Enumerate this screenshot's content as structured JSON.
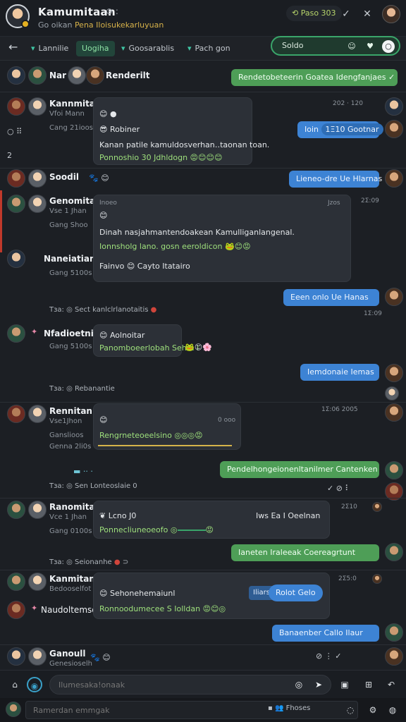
{
  "header": {
    "title": "Kamumitaan",
    "title_badges": "⊙ :",
    "subtitle_prefix": "Go oikan",
    "subtitle_accent": "Pena Iloisukekarluyuan",
    "chip": "⟲ Paso 303",
    "icons": [
      "check-icon",
      "close-icon",
      "tools-icon"
    ]
  },
  "tabs": {
    "items": [
      "Lannilie",
      "Uogiha",
      "Goosarablis",
      "Pach gon"
    ],
    "active_index": 1
  },
  "search": {
    "label": "Soldo"
  },
  "messages": {
    "r1": {
      "name": "Nar",
      "name2": "Renderilt",
      "out_text": "Rendetobeteerin Goatea Idengfanjaes",
      "out_icon": "✓"
    },
    "r2": {
      "name": "Kannmitan",
      "meta1": "Vfoi Mann",
      "meta2": "Cang 21ioos",
      "bubble_line1": "😊 ●",
      "bubble_line2": "😎 Robiner",
      "bubble_main": "Kanan patile  kamuldosverhan‥taonan toan.",
      "bubble_green": "Ponnoshio  30 Jdhldogn",
      "time_top": "202  ·  120",
      "out_text": "Ioin",
      "out_chip": "1Ξ10 Gootnar",
      "side_icons": "○ ⠿",
      "side_count": "2"
    },
    "r3": {
      "name": "Soodil",
      "out_text": "Lieneo-dre Ue Hlarnas"
    },
    "r4": {
      "name": "Genomitan",
      "meta1": "Vse 1 Jhan",
      "meta2": "Gang Shoo",
      "name2": "Naneiatian",
      "meta3": "Gang 5100s",
      "bubble_head": "Inoeo",
      "bubble_head_r": "Jzos",
      "bubble_main": "Dinah nasjahmantendoakean Kamulliganlangenal.",
      "bubble_green": "Ionnsholg lano.  gosn eeroldicon",
      "bubble_footer": "Fainvo  😊  Cayto Itatairo",
      "time": "2Σ:09",
      "out_text": "Eeen onlo Ue Hanas",
      "out_time": "1Σ:09",
      "sys": "Sect kanlclrlanotaitis"
    },
    "r5": {
      "name": "Nfadioetnia",
      "meta1": "Gang 5100s",
      "bubble_line1": "😊  Aolnoitar",
      "bubble_green": "Panomboeerlobah Sehm I",
      "out_text": "Iemdonaie Iemas",
      "sys": "Rebanantie"
    },
    "r6": {
      "name": "Rennitan",
      "meta1": "Vse1Jhon",
      "meta2": "Ganslioos",
      "meta3": "Genna 2li0s",
      "bubble_line1": "😊",
      "bubble_head_r": "0 ooo",
      "bubble_green": "Rengrneteoeelsino",
      "time_top": "1Σ:06  2005",
      "out_text": "Pendelhongeionenltanilmer Cantenken",
      "sys": "Sen Lonteoslaie 0",
      "tool_icons": "✓  ⊘  ⠇"
    },
    "r7": {
      "name": "Ranomitan",
      "meta1": "Vce 1 Jhan",
      "meta2": "Gang 0100s",
      "bubble_line1": "❦ Lcno J0",
      "bubble_green": "Ponnecliuneoeofo",
      "bubble_right": "Iws  Ea I Oeelnan",
      "time_top": "2Σ10",
      "out_text": "Ianeten Iraleeak Coereagrtunt",
      "sys": "Seionanhe"
    },
    "r8": {
      "name": "Kanmitan",
      "meta1": "Bedooselfot",
      "name2": "Naudoltemso",
      "bubble_line1": "😊  Sehonehemaiunl",
      "bubble_green": "Ronnoodumecee  S Iolldan",
      "bubble_chip_a": "Iliars",
      "bubble_chip_b": "Rolot Gelo",
      "time_top": "2Σ5:0",
      "out_text": "Banaenber Callo Ilaur"
    },
    "r9": {
      "name": "Ganoull",
      "meta1": "Genesioselh",
      "tool_icons": "⊘  ⋮  ✓"
    }
  },
  "composer": {
    "placeholder": "Ilumesaka!onaak",
    "icons": [
      "home-icon",
      "camera-icon",
      "send-icon",
      "attach-icon",
      "image-icon",
      "grid-icon",
      "reply-icon"
    ]
  },
  "bottom": {
    "placeholder": "Ramerdan emmgak",
    "chip": "Fhoses"
  },
  "colors": {
    "bg": "#1c1f24",
    "bubble_in": "#2c3037",
    "bubble_out_blue": "#3d83d4",
    "bubble_out_green": "#4e9e57",
    "accent_green_text": "#9ee07c",
    "accent_teal": "#3fc6a4"
  }
}
